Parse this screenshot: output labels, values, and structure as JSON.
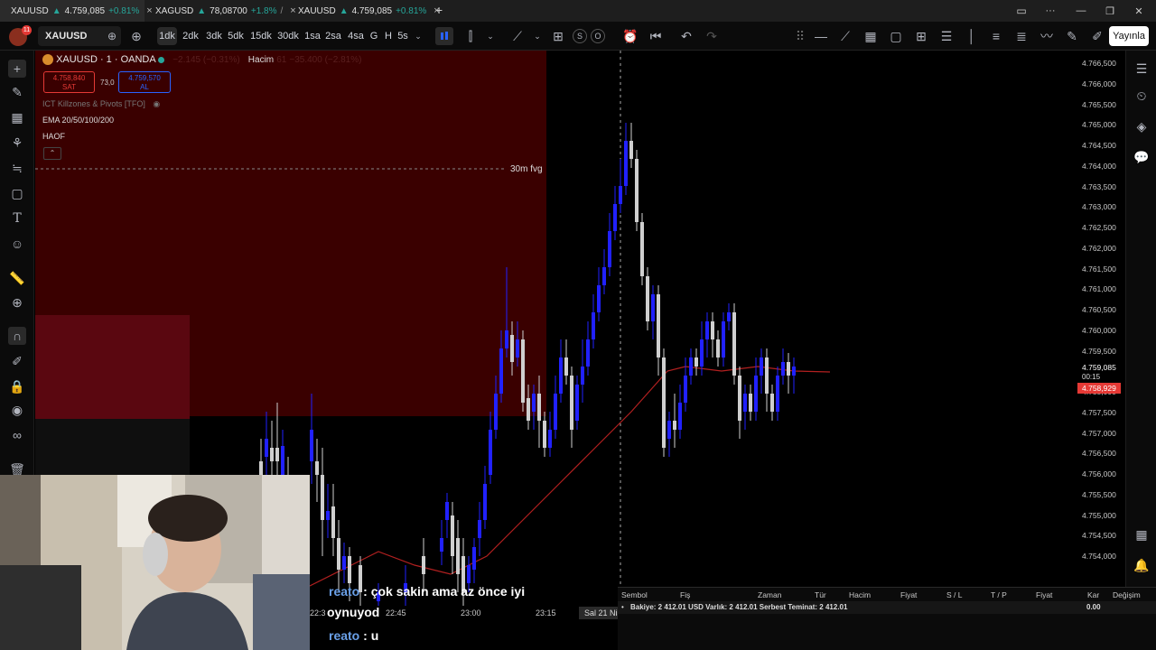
{
  "tabs": [
    {
      "symbol": "XAUUSD",
      "arrow": "▲",
      "price": "4.759,085",
      "change": "+0.81%",
      "close": "×"
    },
    {
      "symbol": "XAGUSD",
      "arrow": "▲",
      "price": "78,08700",
      "change": "+1.8%",
      "extra": "/",
      "close": "×"
    },
    {
      "symbol": "XAUUSD",
      "arrow": "▲",
      "price": "4.759,085",
      "change": "+0.81%",
      "close": "×"
    }
  ],
  "new_tab": "+",
  "window": {
    "minimize": "—",
    "restore": "❐",
    "close": "✕",
    "more": "···"
  },
  "toolbar": {
    "notif_count": "11",
    "symbol": "XAUUSD",
    "intervals": [
      "1dk",
      "2dk",
      "3dk",
      "5dk",
      "15dk",
      "30dk",
      "1sa",
      "2sa",
      "4sa",
      "G",
      "H",
      "5s"
    ],
    "selected_interval": "1dk",
    "s_label": "S",
    "o_label": "O",
    "publish": "Yayınla"
  },
  "legend": {
    "title": "XAUUSD · 1 · OANDA",
    "change": "−2.145 (−0.31%)",
    "volume_label": "Hacim",
    "volume_value": "61",
    "volume_change": "−35.400 (−2.81%)",
    "sell_price": "4.758,840",
    "sell_label": "SAT",
    "spread": "73,0",
    "buy_price": "4.759,570",
    "buy_label": "AL",
    "indicators": [
      "ICT Killzones & Pivots [TFO]",
      "EMA 20/50/100/200",
      "HAOF"
    ],
    "fvg_label": "30m fvg"
  },
  "price_axis": {
    "labels": [
      "4.766,500",
      "4.766,000",
      "4.765,500",
      "4.765,000",
      "4.764,500",
      "4.764,000",
      "4.763,500",
      "4.763,000",
      "4.762,500",
      "4.762,000",
      "4.761,500",
      "4.761,000",
      "4.760,500",
      "4.760,000",
      "4.759,500",
      "4.759,085",
      "4.758,929",
      "4.758,000",
      "4.757,500",
      "4.757,000",
      "4.756,500",
      "4.756,000",
      "4.755,500",
      "4.755,000",
      "4.754,500",
      "4.754,000"
    ],
    "countdown": "00:15",
    "current_price": "4.758,929"
  },
  "time_axis": {
    "labels": [
      "22:3",
      "22:45",
      "23:00",
      "23:15"
    ],
    "date_label": "Sal 21 Nis"
  },
  "trade_panel": {
    "columns": [
      "Sembol",
      "Fiş",
      "Zaman",
      "Tür",
      "Hacim",
      "Fiyat",
      "S / L",
      "T / P",
      "Fiyat",
      "Kar",
      "Değişim"
    ],
    "account": "Bakiye: 2 412.01 USD  Varlık: 2 412.01  Serbest Teminat: 2 412.01",
    "profit": "0.00"
  },
  "chat": [
    {
      "user": "reato",
      "sep": " : ",
      "message": "çok sakin ama az önce iyi",
      "continuation": "oynuyod"
    },
    {
      "user": "reato",
      "sep": " : ",
      "message": "u"
    }
  ],
  "colors": {
    "bull": "#2121ff",
    "bear": "#cfcfcf",
    "zone": "#3a0000",
    "zone2": "#5a0710",
    "ema": "#b32020",
    "accent": "#e53935"
  },
  "icons": {
    "left": [
      "crosshair-icon",
      "trendline-icon",
      "fib-icon",
      "pattern-icon",
      "forecast-icon",
      "shape-icon",
      "text-icon",
      "emoji-icon",
      "ruler-icon",
      "zoom-icon",
      "magnet-icon",
      "lock-draw-icon",
      "lock-icon",
      "eye-icon",
      "link-icon",
      "trash-icon"
    ],
    "right": [
      "watchlist-icon",
      "alert-icon",
      "layers-icon",
      "chat-icon",
      "calendar-icon",
      "bell-icon",
      "help-icon"
    ]
  }
}
